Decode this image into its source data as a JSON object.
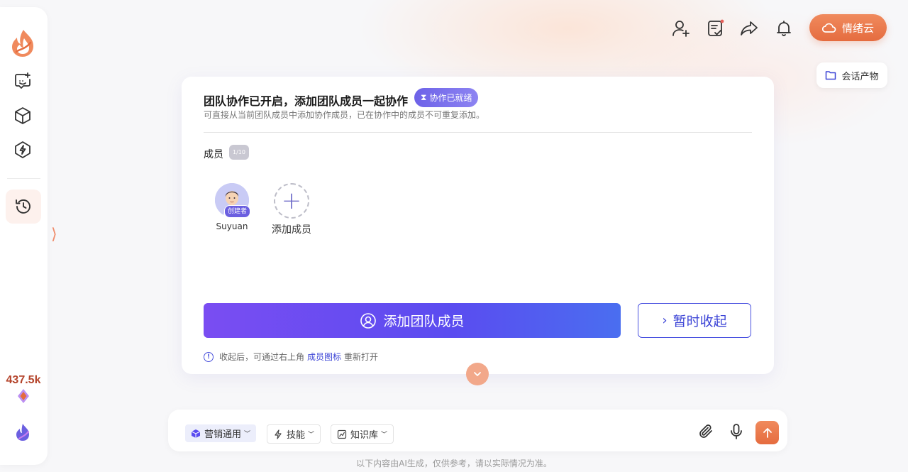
{
  "sidebar": {
    "credits": "437.5k"
  },
  "header": {
    "cloud_label": "情绪云",
    "artifacts_label": "会话产物"
  },
  "card": {
    "title": "团队协作已开启，添加团队成员一起协作",
    "ready_badge": "协作已就绪",
    "subtitle": "可直接从当前团队成员中添加协作成员，已在协作中的成员不可重复添加。",
    "members_label": "成员",
    "member_count": "1/10",
    "members": [
      {
        "name": "Suyuan",
        "tag": "创建者"
      }
    ],
    "add_member_label": "添加成员",
    "primary_button": "添加团队成员",
    "secondary_button": "暂时收起",
    "hint_prefix": "收起后，可通过右上角",
    "hint_link": "成员图标",
    "hint_suffix": "重新打开"
  },
  "input_bar": {
    "model_label": "营销通用",
    "skill_label": "技能",
    "kb_label": "知识库"
  },
  "footer_note": "以下内容由AI生成，仅供参考，请以实际情况为准。",
  "colors": {
    "accent_orange": "#e56c3f",
    "accent_purple": "#5a4cf0",
    "link_blue": "#3c44d6"
  }
}
